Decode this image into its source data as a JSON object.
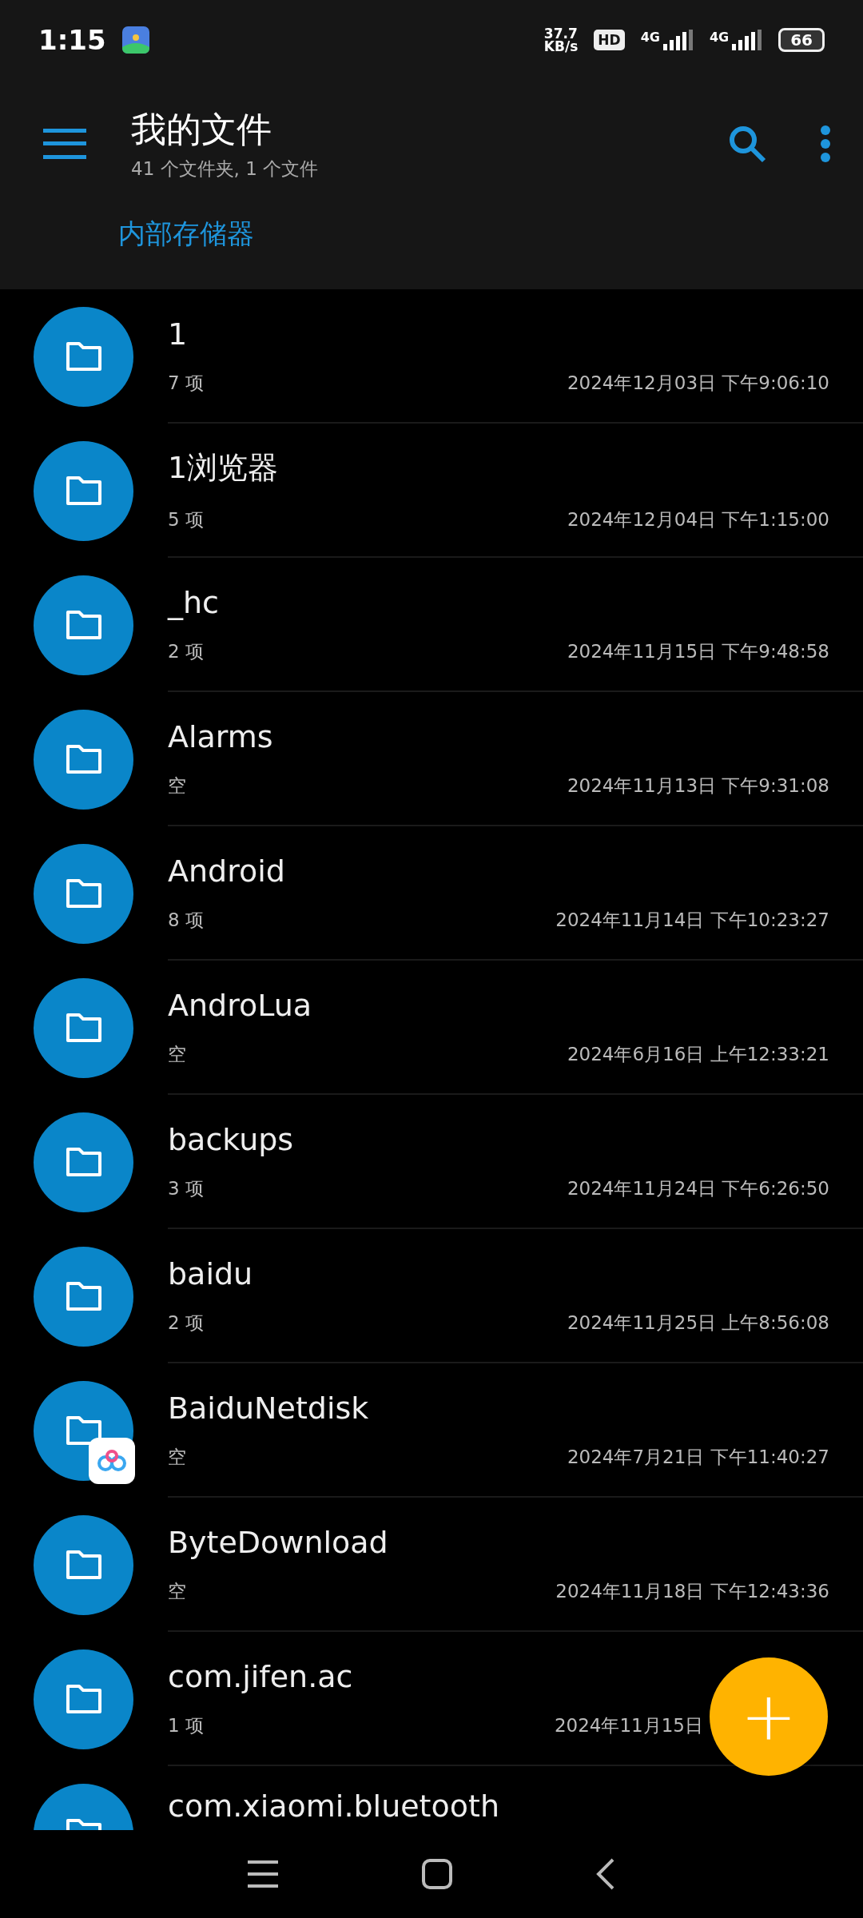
{
  "status_bar": {
    "time": "1:15",
    "speed_value": "37.7",
    "speed_unit": "KB/s",
    "hd": "HD",
    "network_1": "4G",
    "network_2": "4G",
    "battery": "66"
  },
  "header": {
    "title": "我的文件",
    "subtitle": "41 个文件夹, 1 个文件",
    "breadcrumb": "内部存储器"
  },
  "files": [
    {
      "name": "1",
      "count": "7 项",
      "date": "2024年12月03日 下午9:06:10",
      "badge": false
    },
    {
      "name": "1浏览器",
      "count": "5 项",
      "date": "2024年12月04日 下午1:15:00",
      "badge": false
    },
    {
      "name": "_hc",
      "count": "2 项",
      "date": "2024年11月15日 下午9:48:58",
      "badge": false
    },
    {
      "name": "Alarms",
      "count": "空",
      "date": "2024年11月13日 下午9:31:08",
      "badge": false
    },
    {
      "name": "Android",
      "count": "8 项",
      "date": "2024年11月14日 下午10:23:27",
      "badge": false
    },
    {
      "name": "AndroLua",
      "count": "空",
      "date": "2024年6月16日 上午12:33:21",
      "badge": false
    },
    {
      "name": "backups",
      "count": "3 项",
      "date": "2024年11月24日 下午6:26:50",
      "badge": false
    },
    {
      "name": "baidu",
      "count": "2 项",
      "date": "2024年11月25日 上午8:56:08",
      "badge": false
    },
    {
      "name": "BaiduNetdisk",
      "count": "空",
      "date": "2024年7月21日 下午11:40:27",
      "badge": true
    },
    {
      "name": "ByteDownload",
      "count": "空",
      "date": "2024年11月18日 下午12:43:36",
      "badge": false
    },
    {
      "name": "com.jifen.ac",
      "count": "1 项",
      "date": "2024年11月15日",
      "badge": false
    },
    {
      "name": "com.xiaomi.bluetooth",
      "badge": false
    }
  ],
  "fab": {
    "symbol": "+"
  }
}
